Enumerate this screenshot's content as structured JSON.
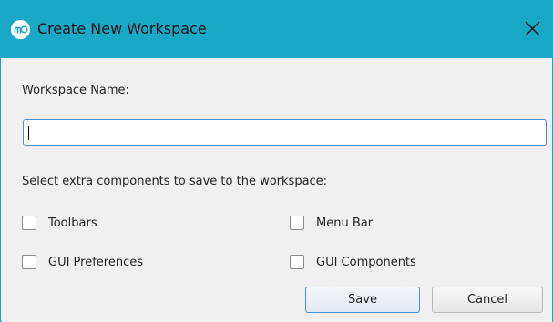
{
  "window": {
    "title": "Create New Workspace",
    "app_icon": "app-logo-icon",
    "close_icon": "close-icon",
    "accent_color": "#1aa8c7"
  },
  "form": {
    "name_label": "Workspace Name:",
    "name_value": "",
    "components_label": "Select extra components to save to the workspace:",
    "options": [
      {
        "label": "Toolbars",
        "checked": false
      },
      {
        "label": "Menu Bar",
        "checked": false
      },
      {
        "label": "GUI Preferences",
        "checked": false
      },
      {
        "label": "GUI Components",
        "checked": false
      }
    ]
  },
  "buttons": {
    "save_label": "Save",
    "cancel_label": "Cancel"
  }
}
